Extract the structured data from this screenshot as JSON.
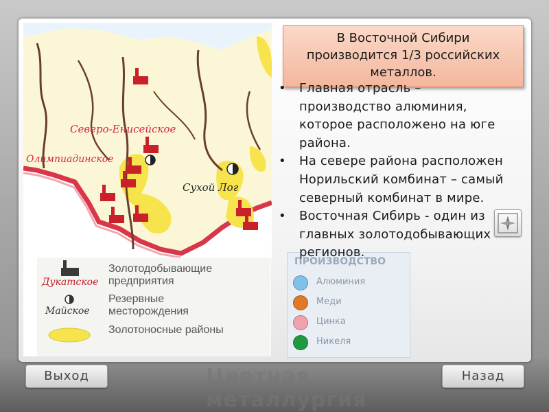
{
  "slide": {
    "title": "В Восточной Сибири производится 1/3 российских металлов.",
    "bullets": [
      "Главная отрасль – производство алюминия, которое расположено на юге района.",
      "На севере района расположен Норильский комбинат – самый северный комбинат в мире.",
      "Восточная Сибирь - один из главных золотодобывающих регионов."
    ],
    "bullet_symbol": "•"
  },
  "map": {
    "labels": [
      "Северо-Енисейское",
      "Олимпиадинское",
      "Сухой Лог"
    ],
    "colors": {
      "land": "#fbf7d6",
      "border": "#d8374a",
      "gold": "#f7e34c",
      "river": "#6a3f2a"
    }
  },
  "legend": {
    "items": [
      {
        "place": "Дукатское",
        "text": "Золотодобывающие предприятия",
        "icon": "factory-icon"
      },
      {
        "place": "Майское",
        "text": "Резервные месторождения",
        "icon": "half-circle-icon"
      },
      {
        "place": "",
        "text": "Золотоносные районы",
        "icon": "gold-area-icon"
      }
    ]
  },
  "production": {
    "header": "ПРОИЗВОДСТВО",
    "items": [
      {
        "label": "Алюминия",
        "color": "#7fc1ea"
      },
      {
        "label": "Меди",
        "color": "#e07a2a"
      },
      {
        "label": "Цинка",
        "color": "#f0a2ad"
      },
      {
        "label": "Никеля",
        "color": "#1f9a43"
      }
    ]
  },
  "nav": {
    "exit_label": "Выход",
    "back_label": "Назад"
  },
  "watermark": "Цветная\nметаллургия",
  "compass": {
    "icon": "compass-icon"
  }
}
